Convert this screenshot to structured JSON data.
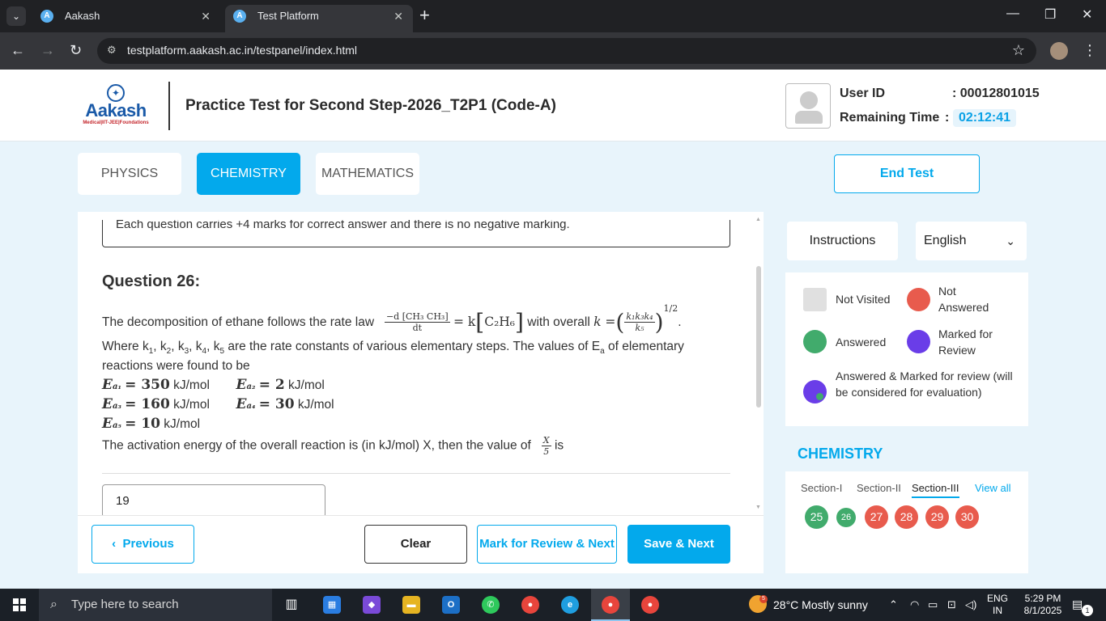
{
  "browser": {
    "tabs": [
      {
        "title": "Aakash",
        "active": false
      },
      {
        "title": "Test Platform",
        "active": true
      }
    ],
    "url": "testplatform.aakash.ac.in/testpanel/index.html"
  },
  "header": {
    "logo_word": "Aakash",
    "logo_tagline": "Medical|IIT-JEE|Foundations",
    "test_title": "Practice Test for Second Step-2026_T2P1 (Code-A)",
    "user_id_label": "User ID",
    "user_id_value": ": 00012801015",
    "remaining_time_label": "Remaining Time",
    "colon": ":",
    "remaining_time_value": "02:12:41"
  },
  "subjects": [
    {
      "label": "PHYSICS",
      "active": false
    },
    {
      "label": "CHEMISTRY",
      "active": true
    },
    {
      "label": "MATHEMATICS",
      "active": false
    }
  ],
  "end_test_label": "End Test",
  "question": {
    "instruction": "Each question carries +4 marks for correct answer and there is no negative marking.",
    "heading": "Question 26:",
    "intro": "The decomposition of ethane follows the rate law",
    "rate_num": "−d [CH₃ CH₃]",
    "rate_den": "dt",
    "rate_rhs": "= k",
    "rate_species": "C₂H₆",
    "with_overall": "with overall",
    "k_eq": "k =",
    "k_num": "k₁k₃k₄",
    "k_den": "k₅",
    "k_power": "1/2",
    "period": ".",
    "line2_a": "Where k",
    "line2_b": "are the rate constants of various elementary steps. The values of E",
    "line2_c": "of elementary",
    "line3": "reactions were found to be",
    "energies": [
      {
        "sub": "1",
        "value": "350",
        "unit": "kJ/mol"
      },
      {
        "sub": "2",
        "value": "2",
        "unit": "kJ/mol"
      },
      {
        "sub": "3",
        "value": "160",
        "unit": "kJ/mol"
      },
      {
        "sub": "4",
        "value": "30",
        "unit": "kJ/mol"
      },
      {
        "sub": "5",
        "value": "10",
        "unit": "kJ/mol"
      }
    ],
    "final_line": "The activation energy of the overall reaction is (in kJ/mol) X, then the value of",
    "frac_num": "X",
    "frac_den": "5",
    "is_word": "is",
    "answer_value": "19"
  },
  "buttons": {
    "previous": "Previous",
    "clear": "Clear",
    "mark_review": "Mark for Review & Next",
    "save_next": "Save & Next"
  },
  "side": {
    "instructions_label": "Instructions",
    "language": "English",
    "legend": {
      "not_visited": "Not Visited",
      "not_answered": "Not Answered",
      "answered": "Answered",
      "marked": "Marked for Review",
      "answered_marked": "Answered & Marked for review (will be considered for evaluation)"
    },
    "palette_title": "CHEMISTRY",
    "sections": [
      "Section-I",
      "Section-II",
      "Section-III"
    ],
    "view_all": "View all",
    "questions": [
      {
        "no": "25",
        "status": "answered"
      },
      {
        "no": "26",
        "status": "answered"
      },
      {
        "no": "27",
        "status": "not_answered"
      },
      {
        "no": "28",
        "status": "not_answered"
      },
      {
        "no": "29",
        "status": "not_answered"
      },
      {
        "no": "30",
        "status": "not_answered"
      }
    ]
  },
  "colors": {
    "accent": "#03a9ec",
    "answered": "#41ab6c",
    "not_answered": "#e85b4d",
    "marked": "#6a3de8",
    "not_visited": "#e0e0e0"
  },
  "taskbar": {
    "search_placeholder": "Type here to search",
    "weather_badge": "5",
    "weather": "28°C  Mostly sunny",
    "lang_top": "ENG",
    "lang_bottom": "IN",
    "time": "5:29 PM",
    "date": "8/1/2025",
    "notifications": "1"
  }
}
